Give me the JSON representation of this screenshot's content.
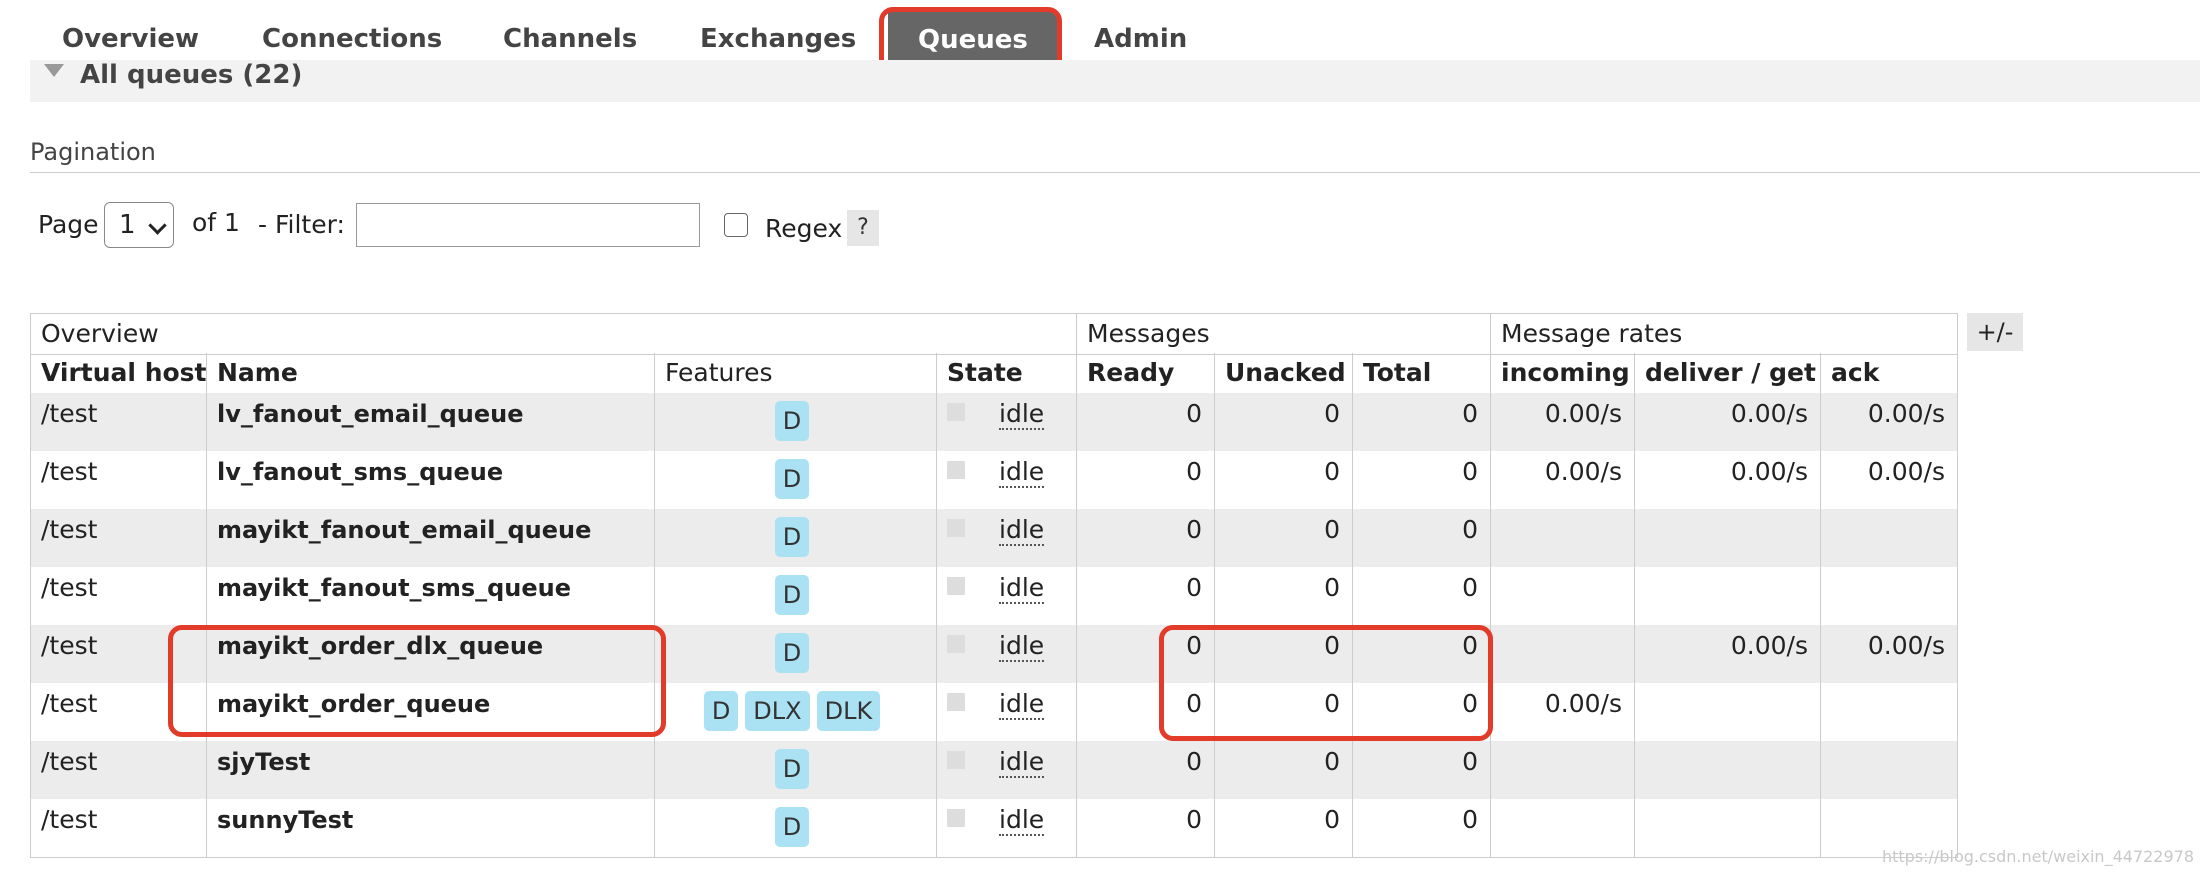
{
  "nav": {
    "tabs": [
      "Overview",
      "Connections",
      "Channels",
      "Exchanges",
      "Queues",
      "Admin"
    ],
    "active_tab": "Queues"
  },
  "section": {
    "title": "All queues (22)"
  },
  "pagination": {
    "heading": "Pagination",
    "page_label": "Page",
    "page_value": "1",
    "of_label": "of 1",
    "filter_label": "- Filter:",
    "filter_value": "",
    "regex_label": "Regex",
    "help_label": "?"
  },
  "table": {
    "group_headers": [
      "Overview",
      "Messages",
      "Message rates"
    ],
    "columns": [
      "Virtual host",
      "Name",
      "Features",
      "State",
      "Ready",
      "Unacked",
      "Total",
      "incoming",
      "deliver / get",
      "ack"
    ],
    "toggle_label": "+/-",
    "rows": [
      {
        "vhost": "/test",
        "name": "lv_fanout_email_queue",
        "features": [
          "D"
        ],
        "state": "idle",
        "ready": "0",
        "unacked": "0",
        "total": "0",
        "incoming": "0.00/s",
        "deliver_get": "0.00/s",
        "ack": "0.00/s"
      },
      {
        "vhost": "/test",
        "name": "lv_fanout_sms_queue",
        "features": [
          "D"
        ],
        "state": "idle",
        "ready": "0",
        "unacked": "0",
        "total": "0",
        "incoming": "0.00/s",
        "deliver_get": "0.00/s",
        "ack": "0.00/s"
      },
      {
        "vhost": "/test",
        "name": "mayikt_fanout_email_queue",
        "features": [
          "D"
        ],
        "state": "idle",
        "ready": "0",
        "unacked": "0",
        "total": "0",
        "incoming": "",
        "deliver_get": "",
        "ack": ""
      },
      {
        "vhost": "/test",
        "name": "mayikt_fanout_sms_queue",
        "features": [
          "D"
        ],
        "state": "idle",
        "ready": "0",
        "unacked": "0",
        "total": "0",
        "incoming": "",
        "deliver_get": "",
        "ack": ""
      },
      {
        "vhost": "/test",
        "name": "mayikt_order_dlx_queue",
        "features": [
          "D"
        ],
        "state": "idle",
        "ready": "0",
        "unacked": "0",
        "total": "0",
        "incoming": "",
        "deliver_get": "0.00/s",
        "ack": "0.00/s"
      },
      {
        "vhost": "/test",
        "name": "mayikt_order_queue",
        "features": [
          "D",
          "DLX",
          "DLK"
        ],
        "state": "idle",
        "ready": "0",
        "unacked": "0",
        "total": "0",
        "incoming": "0.00/s",
        "deliver_get": "",
        "ack": ""
      },
      {
        "vhost": "/test",
        "name": "sjyTest",
        "features": [
          "D"
        ],
        "state": "idle",
        "ready": "0",
        "unacked": "0",
        "total": "0",
        "incoming": "",
        "deliver_get": "",
        "ack": ""
      },
      {
        "vhost": "/test",
        "name": "sunnyTest",
        "features": [
          "D"
        ],
        "state": "idle",
        "ready": "0",
        "unacked": "0",
        "total": "0",
        "incoming": "",
        "deliver_get": "",
        "ack": ""
      }
    ]
  },
  "watermark": "https://blog.csdn.net/weixin_44722978",
  "colors": {
    "highlight": "#e23b2a",
    "badge": "#aae1f3",
    "active_tab": "#666666"
  }
}
